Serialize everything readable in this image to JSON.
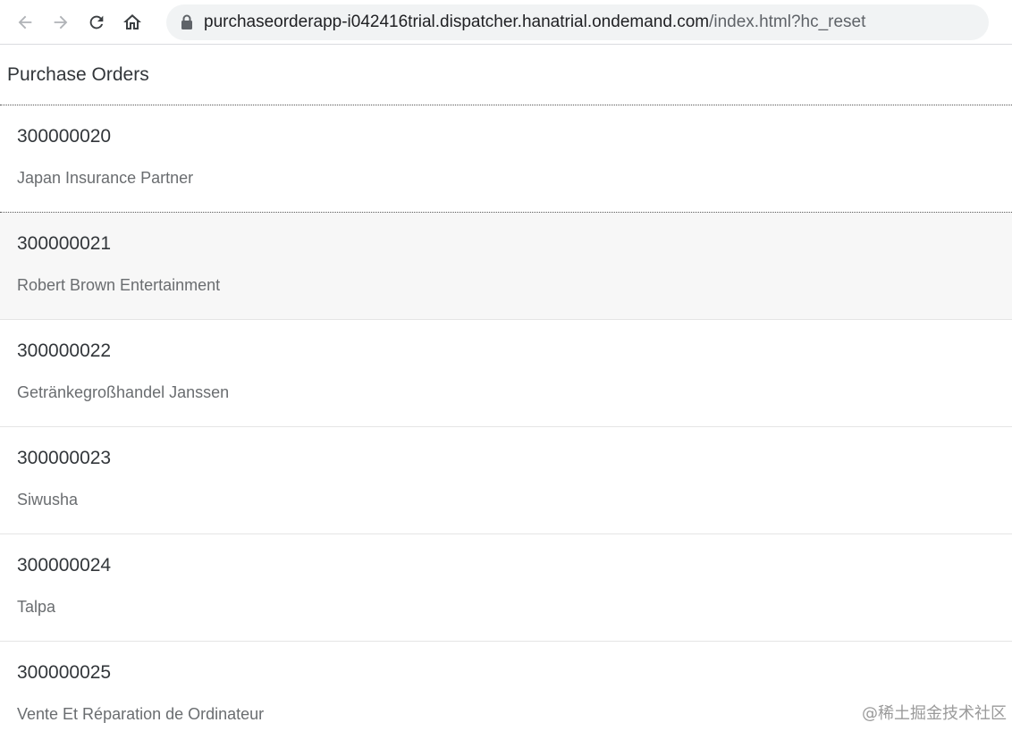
{
  "browser": {
    "url_host": "purchaseorderapp-i042416trial.dispatcher.hanatrial.ondemand.com",
    "url_path": "/index.html?hc_reset",
    "icons": [
      "back-arrow-icon",
      "forward-arrow-icon",
      "reload-icon",
      "home-icon",
      "lock-icon"
    ]
  },
  "page": {
    "title": "Purchase Orders"
  },
  "orders": [
    {
      "id": "300000020",
      "name": "Japan Insurance Partner"
    },
    {
      "id": "300000021",
      "name": "Robert Brown Entertainment"
    },
    {
      "id": "300000022",
      "name": "Getränkegroßhandel Janssen"
    },
    {
      "id": "300000023",
      "name": "Siwusha"
    },
    {
      "id": "300000024",
      "name": "Talpa"
    },
    {
      "id": "300000025",
      "name": "Vente Et Réparation de Ordinateur"
    }
  ],
  "watermark": "@稀土掘金技术社区",
  "colors": {
    "text_primary": "#32363a",
    "text_secondary": "#6a6d70",
    "hover_row": "#f7f7f7",
    "address_bar": "#f1f3f4"
  }
}
